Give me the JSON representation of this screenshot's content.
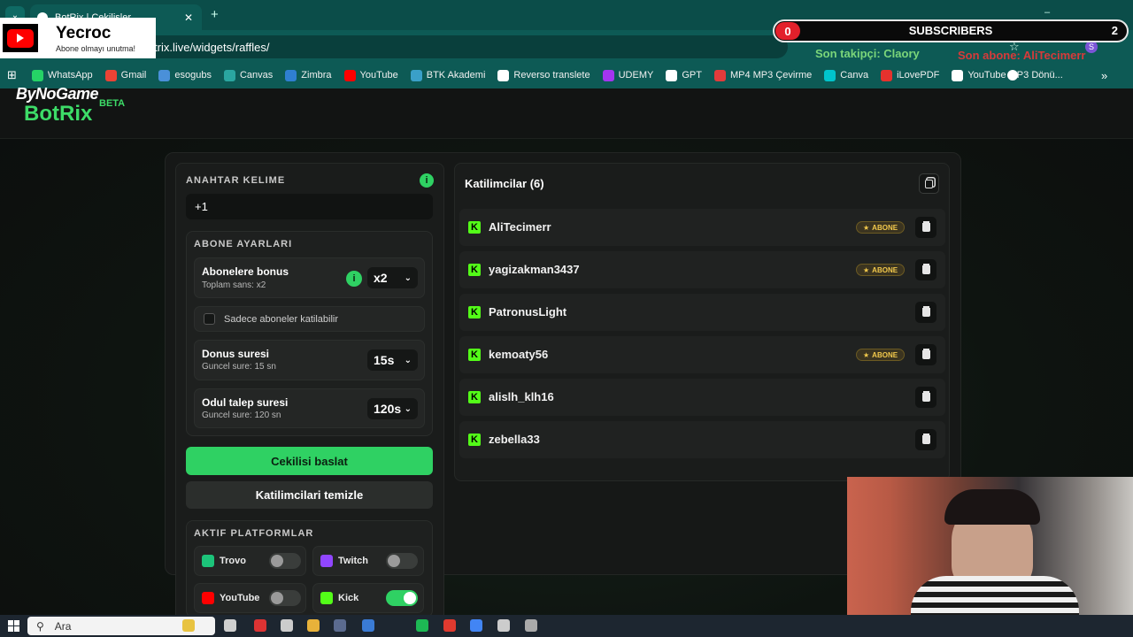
{
  "browser": {
    "tab_title": "BotRix | Cekilisler",
    "url_suffix": "trix.live/widgets/raffles/"
  },
  "bookmarks": [
    {
      "label": "WhatsApp",
      "color": "#25d366"
    },
    {
      "label": "Gmail",
      "color": "#ea4335"
    },
    {
      "label": "esogubs",
      "color": "#4a90d9"
    },
    {
      "label": "Canvas",
      "color": "#2aa6a0"
    },
    {
      "label": "Zimbra",
      "color": "#2f7fd1"
    },
    {
      "label": "YouTube",
      "color": "#ff0000"
    },
    {
      "label": "BTK Akademi",
      "color": "#3aa0c8"
    },
    {
      "label": "Reverso translete",
      "color": "#ffffff"
    },
    {
      "label": "UDEMY",
      "color": "#a435f0"
    },
    {
      "label": "GPT",
      "color": "#ffffff"
    },
    {
      "label": "MP4 MP3 Çevirme",
      "color": "#e23b3b"
    },
    {
      "label": "Canva",
      "color": "#00c4cc"
    },
    {
      "label": "iLovePDF",
      "color": "#e5322d"
    },
    {
      "label": "YouTube MP3 Dönü...",
      "color": "#ffffff"
    }
  ],
  "overlay": {
    "channel": "Yecroc",
    "channel_sub": "Abone olmayı unutma!",
    "subs_left": "0",
    "subs_label": "SUBSCRIBERS",
    "subs_right": "2",
    "last_follower": "Son takipçi: Claory",
    "last_sub": "Son abone: AliTecimerr"
  },
  "logo": {
    "top": "ByNoGame",
    "main": "BotRix",
    "badge": "BETA"
  },
  "settings": {
    "keyword_title": "ANAHTAR KELIME",
    "keyword_value": "+1",
    "sub_title": "ABONE AYARLARI",
    "bonus_title": "Abonelere bonus",
    "bonus_sub": "Toplam sans: x2",
    "bonus_value": "x2",
    "only_subs": "Sadece aboneler katilabilir",
    "spin_title": "Donus suresi",
    "spin_sub": "Guncel sure: 15 sn",
    "spin_value": "15s",
    "claim_title": "Odul talep suresi",
    "claim_sub": "Guncel sure: 120 sn",
    "claim_value": "120s",
    "start_btn": "Cekilisi baslat",
    "clear_btn": "Katilimcilari temizle",
    "platforms_title": "AKTIF PLATFORMLAR",
    "platforms": [
      {
        "name": "Trovo",
        "on": false,
        "color": "#1cc47a"
      },
      {
        "name": "Twitch",
        "on": false,
        "color": "#9146ff"
      },
      {
        "name": "YouTube",
        "on": false,
        "color": "#ff0000"
      },
      {
        "name": "Kick",
        "on": true,
        "color": "#53fc18"
      }
    ]
  },
  "participants": {
    "title": "Katilimcilar (6)",
    "badge_label": "ABONE",
    "list": [
      {
        "name": "AliTecimerr",
        "sub": true
      },
      {
        "name": "yagizakman3437",
        "sub": true
      },
      {
        "name": "PatronusLight",
        "sub": false
      },
      {
        "name": "kemoaty56",
        "sub": true
      },
      {
        "name": "alislh_klh16",
        "sub": false
      },
      {
        "name": "zebella33",
        "sub": false
      }
    ]
  },
  "taskbar": {
    "search": "Ara"
  },
  "colors": {
    "accent": "#2fd163",
    "kick": "#53fc18",
    "chrome": "#0d5a55"
  }
}
